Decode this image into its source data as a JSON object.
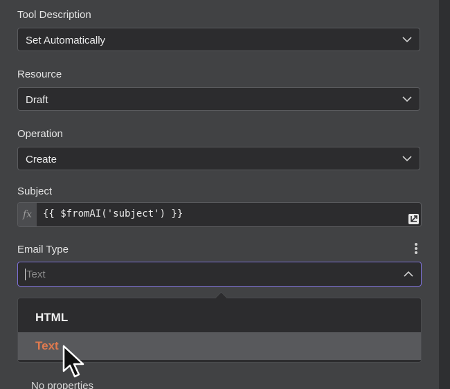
{
  "fields": {
    "tool_description": {
      "label": "Tool Description",
      "value": "Set Automatically"
    },
    "resource": {
      "label": "Resource",
      "value": "Draft"
    },
    "operation": {
      "label": "Operation",
      "value": "Create"
    },
    "subject": {
      "label": "Subject",
      "fx": "fx",
      "expression": "{{ $fromAI('subject') }}"
    },
    "email_type": {
      "label": "Email Type",
      "placeholder": "Text",
      "options": [
        "HTML",
        "Text"
      ],
      "highlighted_option": "Text"
    }
  },
  "footer": {
    "no_properties": "No properties"
  },
  "colors": {
    "background": "#414244",
    "input_bg": "#2c2c2e",
    "focus_border": "#7c6fd6",
    "highlight_text": "#e07a4f"
  },
  "icons": [
    "chevron-down-icon",
    "chevron-up-icon",
    "expand-icon",
    "kebab-icon",
    "mouse-cursor-icon"
  ]
}
